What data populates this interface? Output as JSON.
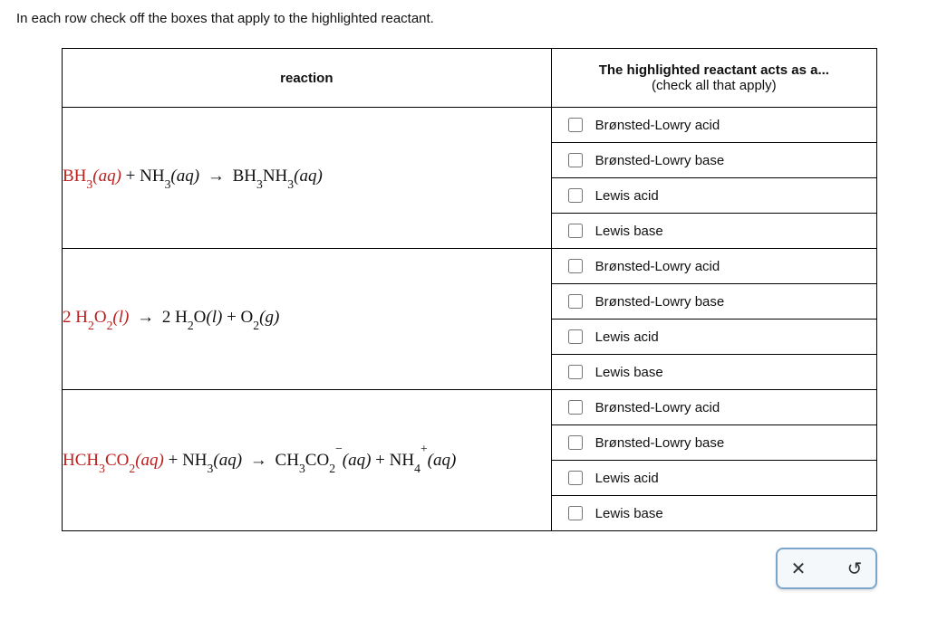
{
  "instructions": "In each row check off the boxes that apply to the highlighted reactant.",
  "headers": {
    "reaction": "reaction",
    "acts_line1": "The highlighted reactant acts as a...",
    "acts_line2": "(check all that apply)"
  },
  "options": {
    "bla": "Brønsted-Lowry acid",
    "blb": "Brønsted-Lowry base",
    "la": "Lewis acid",
    "lb": "Lewis base"
  },
  "rows": [
    {
      "highlighted": "BH3(aq)",
      "plain_rest": " + NH3(aq) → BH3NH3(aq)"
    },
    {
      "highlighted": "2 H2O2(l)",
      "plain_rest": " → 2 H2O(l) + O2(g)"
    },
    {
      "highlighted": "HCH3CO2(aq)",
      "plain_rest": " + NH3(aq) → CH3CO2−(aq) + NH4+(aq)"
    }
  ],
  "buttons": {
    "close": "✕",
    "reset": "↺"
  }
}
